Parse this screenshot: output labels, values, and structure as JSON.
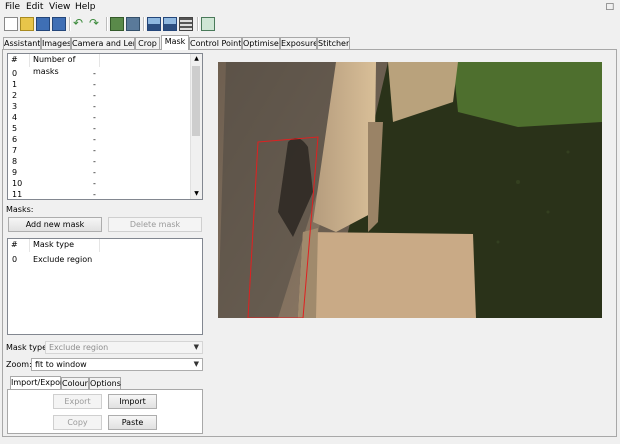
{
  "menu": {
    "file": "File",
    "edit": "Edit",
    "view": "View",
    "help": "Help"
  },
  "toolbar": {
    "icons": [
      "new-project-icon",
      "open-icon",
      "save-icon",
      "save-as-icon",
      "undo-icon",
      "redo-icon",
      "add-images-icon",
      "control-points-icon",
      "align-icon",
      "crop-icon",
      "stitch-icon",
      "preview-icon"
    ]
  },
  "tabs": [
    "Assistant",
    "Images",
    "Camera and Lens",
    "Crop",
    "Mask",
    "Control Points",
    "Optimiser",
    "Exposure",
    "Stitcher"
  ],
  "active_tab": "Mask",
  "images_list": {
    "col_index": "#",
    "col_masks": "Number of masks",
    "rows": [
      {
        "index": "0",
        "masks": "-"
      },
      {
        "index": "1",
        "masks": "-"
      },
      {
        "index": "2",
        "masks": "-"
      },
      {
        "index": "3",
        "masks": "-"
      },
      {
        "index": "4",
        "masks": "-"
      },
      {
        "index": "5",
        "masks": "-"
      },
      {
        "index": "6",
        "masks": "-"
      },
      {
        "index": "7",
        "masks": "-"
      },
      {
        "index": "8",
        "masks": "-"
      },
      {
        "index": "9",
        "masks": "-"
      },
      {
        "index": "10",
        "masks": "-"
      },
      {
        "index": "11",
        "masks": "-"
      }
    ]
  },
  "masks_label": "Masks:",
  "add_mask_button": "Add new mask",
  "delete_mask_button": "Delete mask",
  "mask_list": {
    "col_index": "#",
    "col_type": "Mask type",
    "rows": [
      {
        "index": "0",
        "type": "Exclude region"
      }
    ]
  },
  "mask_type": {
    "label": "Mask type:",
    "value": "Exclude region"
  },
  "zoom": {
    "label": "Zoom:",
    "value": "fit to window"
  },
  "subtabs": [
    "Import/Export",
    "Colour",
    "Options"
  ],
  "export_button": "Export",
  "import_button": "Import",
  "copy_button": "Copy",
  "paste_button": "Paste",
  "colors": {
    "mask_outline": "#e02020",
    "water": "#25301a"
  }
}
